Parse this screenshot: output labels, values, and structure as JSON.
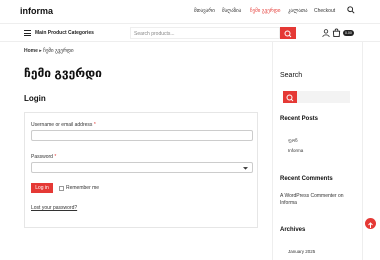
{
  "header": {
    "logo": "informa",
    "nav": [
      "მთავარი",
      "მაღაზია",
      "ჩემი გვერდი",
      "კალათა",
      "Checkout"
    ]
  },
  "catbar": {
    "categories_label": "Main Product Categories",
    "search_placeholder": "Search products...",
    "cart_price": "0.00"
  },
  "breadcrumb": {
    "home": "Home",
    "current": "ჩემი გვერდი"
  },
  "main": {
    "title": "ჩემი გვერდი",
    "login_heading": "Login",
    "username_label": "Username or email address",
    "password_label": "Password",
    "required_mark": "*",
    "login_button": "Log in",
    "remember_label": "Remember me",
    "lost_password": "Lost your password?"
  },
  "sidebar": {
    "search_title": "Search",
    "recent_posts_title": "Recent Posts",
    "recent_posts": [
      "ფონ",
      "Informa"
    ],
    "recent_comments_title": "Recent Comments",
    "recent_comment": "A WordPress Commenter on Informa",
    "archives_title": "Archives",
    "archives": [
      "January 2025"
    ]
  },
  "colors": {
    "accent": "#e53935"
  }
}
